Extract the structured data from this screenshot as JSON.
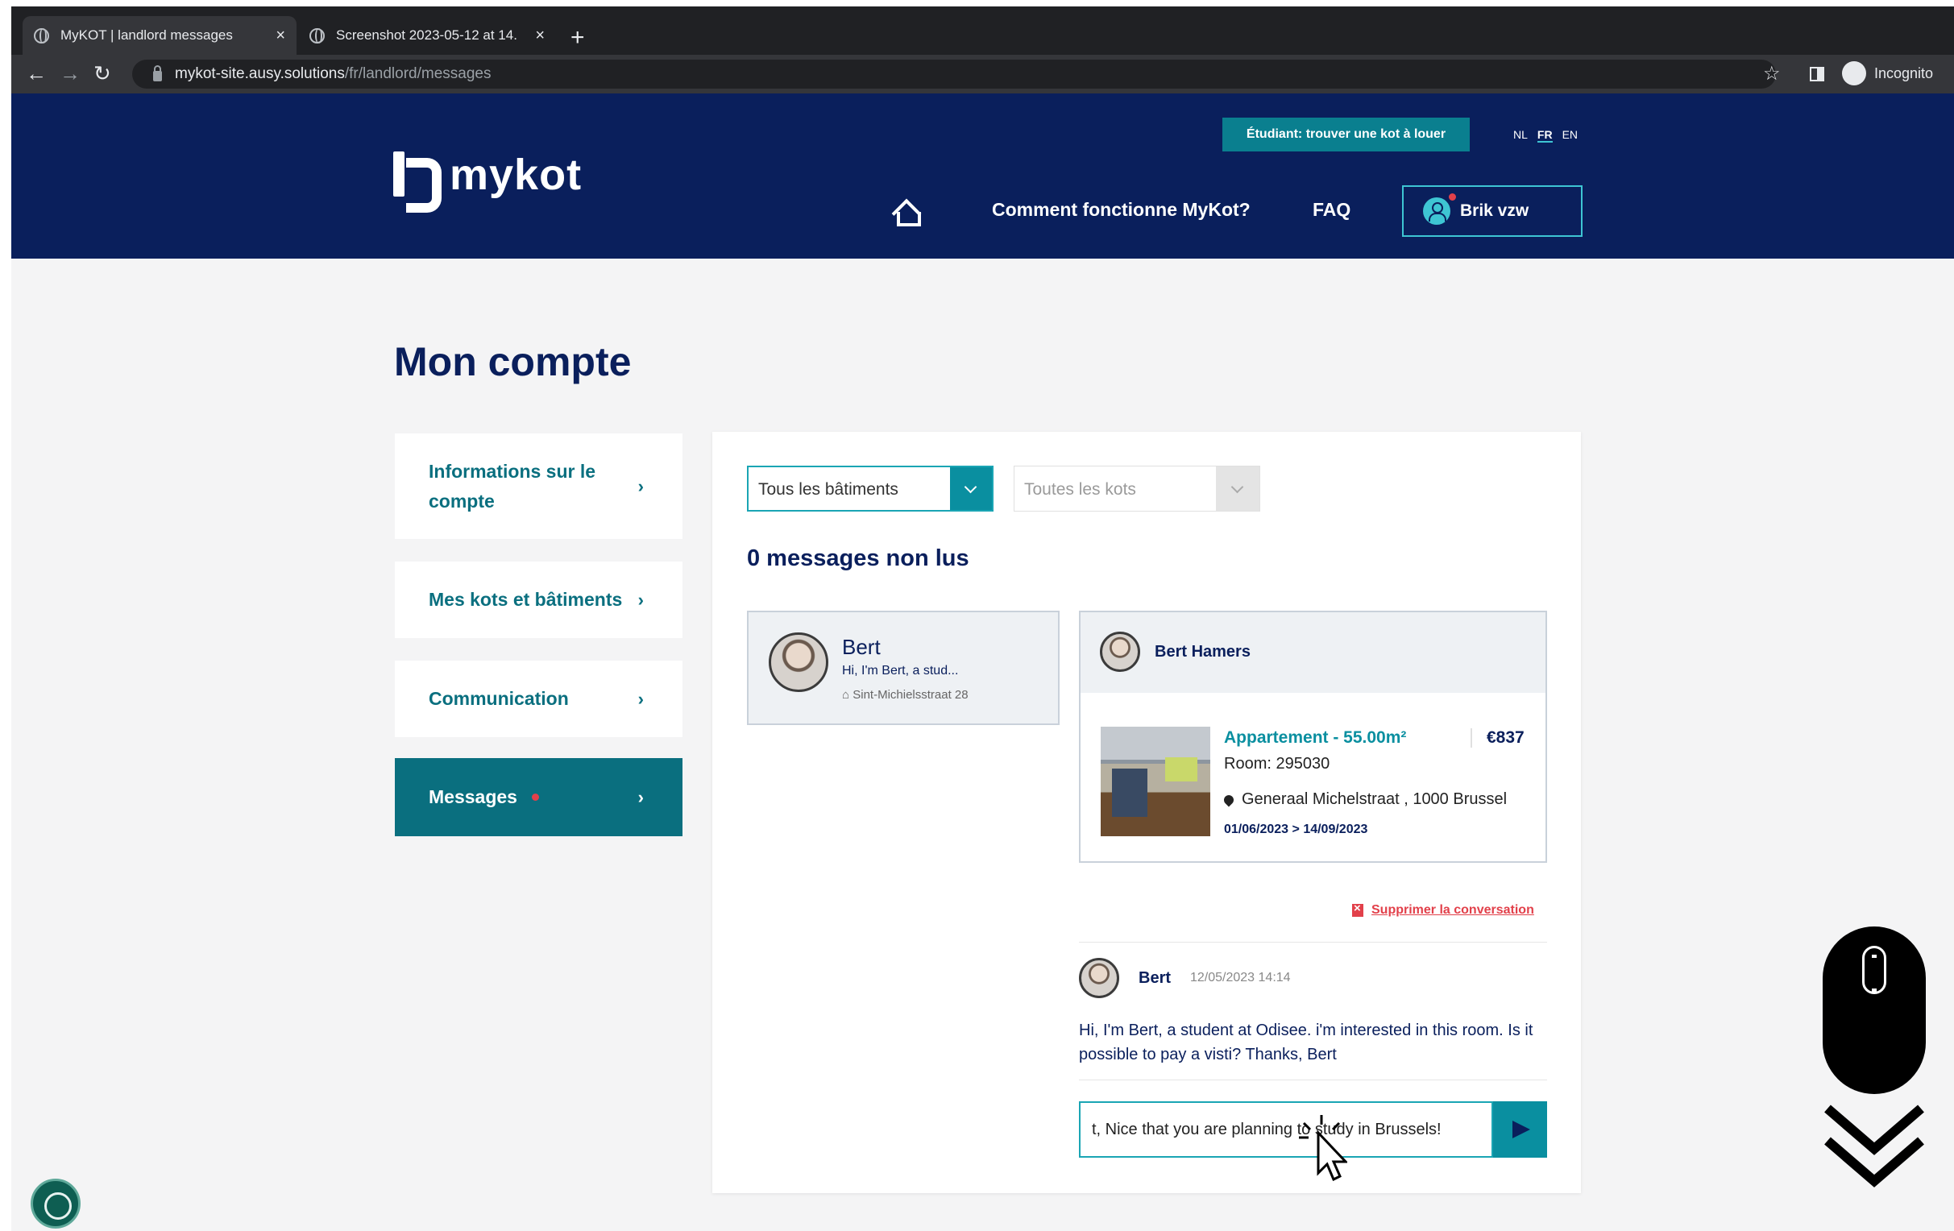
{
  "browser": {
    "tabs": [
      {
        "title": "MyKOT | landlord messages",
        "active": true
      },
      {
        "title": "Screenshot 2023-05-12 at 14.",
        "active": false
      }
    ],
    "url_host": "mykot-site.ausy.solutions",
    "url_path": "/fr/landlord/messages",
    "profile": "Incognito"
  },
  "header": {
    "logo_text": "mykot",
    "student_button": "Étudiant: trouver une kot à louer",
    "languages": [
      "NL",
      "FR",
      "EN"
    ],
    "active_language": "FR",
    "nav": {
      "how": "Comment fonctionne MyKot?",
      "faq": "FAQ"
    },
    "user": "Brik vzw"
  },
  "page": {
    "title": "Mon compte",
    "menu": {
      "account": "Informations sur le compte",
      "kots": "Mes kots et bâtiments",
      "communication": "Communication",
      "messages": "Messages"
    }
  },
  "filters": {
    "buildings": "Tous les bâtiments",
    "kots": "Toutes les kots"
  },
  "unread": "0 messages non lus",
  "conversation": {
    "name": "Bert",
    "preview": "Hi, I'm Bert, a stud...",
    "address": "Sint-Michielsstraat 28"
  },
  "detail": {
    "name": "Bert Hamers",
    "apartment": "Appartement - 55.00m²",
    "price": "€837",
    "room": "Room: 295030",
    "location": "Generaal Michelstraat , 1000 Brussel",
    "dates": "01/06/2023 > 14/09/2023"
  },
  "delete_label": "Supprimer la conversation",
  "message": {
    "author": "Bert",
    "time": "12/05/2023 14:14",
    "text": "Hi, I'm Bert, a student at Odisee. i'm interested in this room. Is it possible to pay a visti? Thanks, Bert"
  },
  "reply": {
    "value": "t, Nice that you are planning to study in Brussels!"
  },
  "colors": {
    "navy": "#0a1f5c",
    "teal": "#0a6f7f",
    "accent": "#0a8fa0",
    "alert": "#e2404a"
  }
}
